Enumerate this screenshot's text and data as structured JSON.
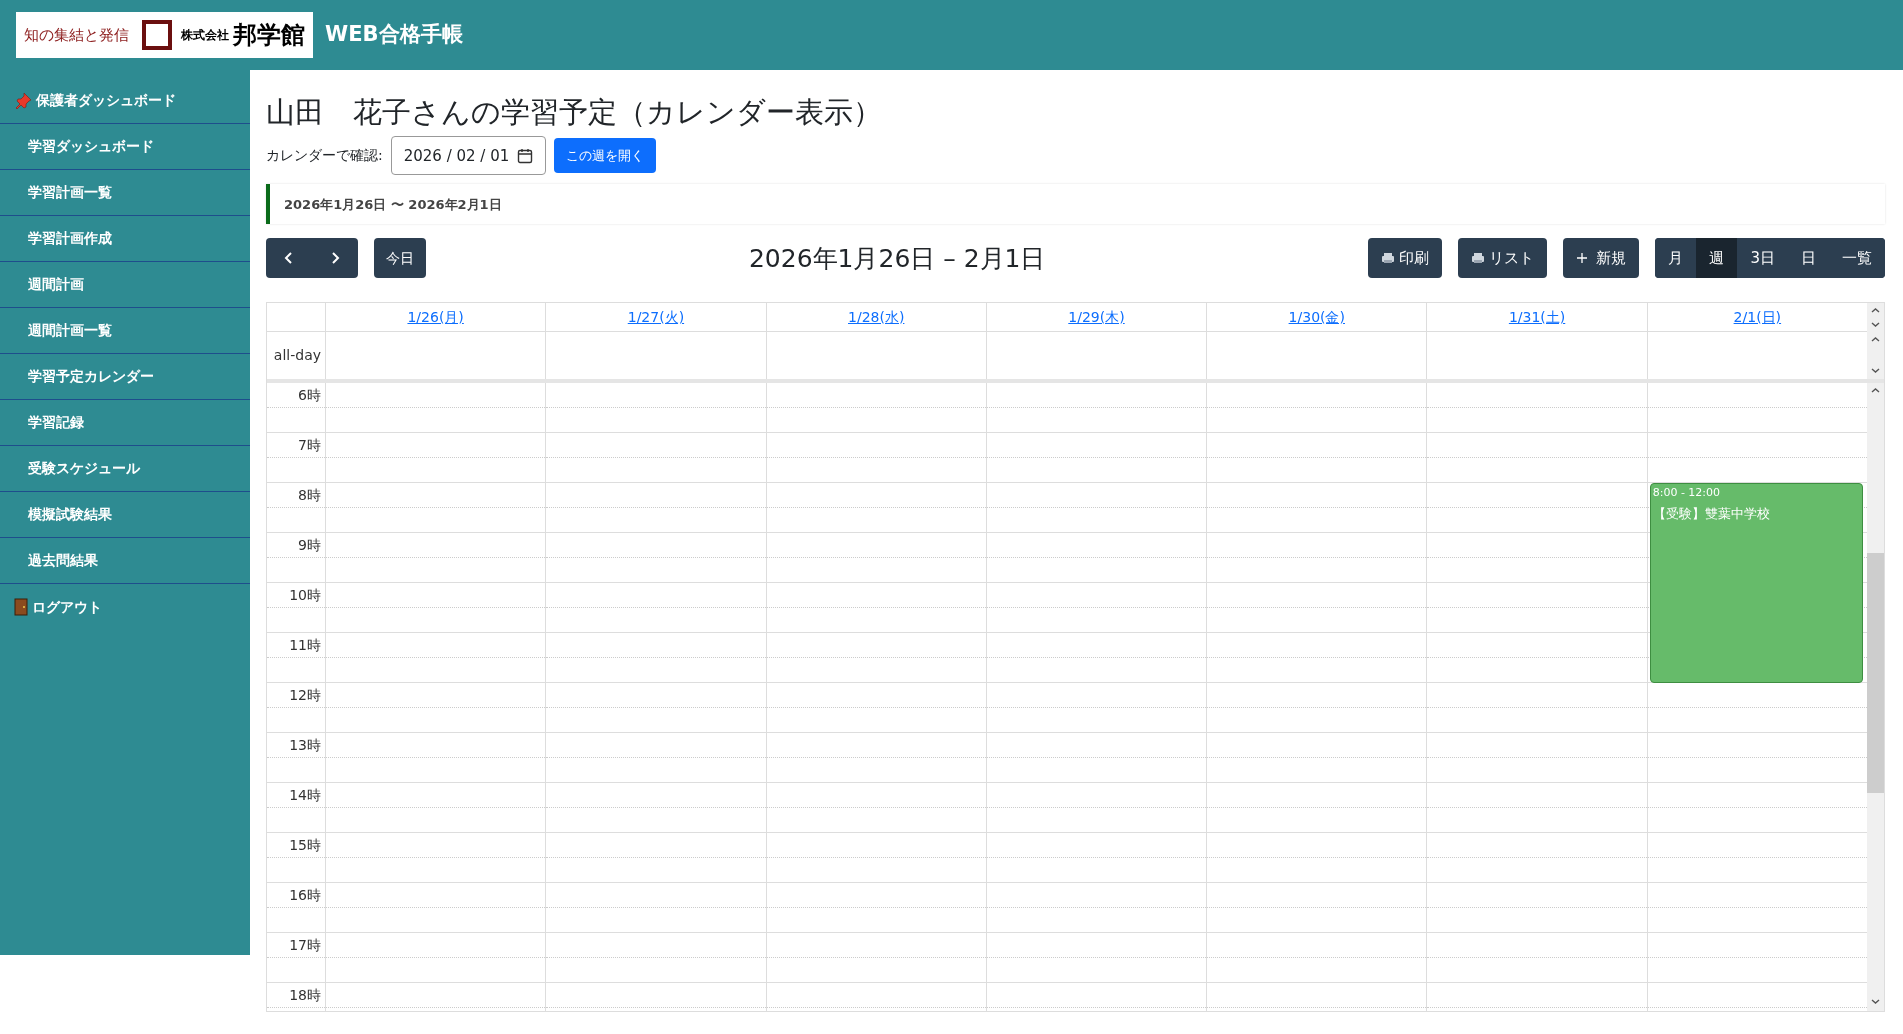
{
  "header": {
    "logo": {
      "tagline": "知の集結と発信",
      "company_prefix": "株式会社",
      "company_name": "邦学館"
    },
    "app_title": "WEB合格手帳"
  },
  "sidebar": {
    "items": [
      {
        "label": "保護者ダッシュボード",
        "kind": "pin"
      },
      {
        "label": "学習ダッシュボード",
        "kind": "link"
      },
      {
        "label": "学習計画一覧",
        "kind": "link"
      },
      {
        "label": "学習計画作成",
        "kind": "link"
      },
      {
        "label": "週間計画",
        "kind": "link"
      },
      {
        "label": "週間計画一覧",
        "kind": "link"
      },
      {
        "label": "学習予定カレンダー",
        "kind": "link"
      },
      {
        "label": "学習記録",
        "kind": "link"
      },
      {
        "label": "受験スケジュール",
        "kind": "link"
      },
      {
        "label": "模擬試験結果",
        "kind": "link"
      },
      {
        "label": "過去問結果",
        "kind": "link"
      },
      {
        "label": "ログアウト",
        "kind": "door"
      }
    ]
  },
  "page_title": "山田　花子さんの学習予定（カレンダー表示）",
  "date_picker": {
    "label": "カレンダーで確認:",
    "value": "2026 / 02 / 01"
  },
  "open_week_button": "この週を開く",
  "range_banner": "2026年1月26日 〜 2026年2月1日",
  "toolbar": {
    "today_button": "今日",
    "calendar_title": "2026年1月26日 – 2月1日",
    "actions": [
      {
        "label": "印刷",
        "kind": "printer"
      },
      {
        "label": "リスト",
        "kind": "printer"
      },
      {
        "label": "新規",
        "kind": "plus"
      }
    ],
    "views": [
      {
        "label": "月",
        "selected": false
      },
      {
        "label": "週",
        "selected": true
      },
      {
        "label": "3日",
        "selected": false
      },
      {
        "label": "日",
        "selected": false
      },
      {
        "label": "一覧",
        "selected": false
      }
    ]
  },
  "calendar": {
    "all_day_label": "all-day",
    "hours": [
      "6時",
      "7時",
      "8時",
      "9時",
      "10時",
      "11時",
      "12時",
      "13時",
      "14時",
      "15時",
      "16時",
      "17時",
      "18時"
    ],
    "days": [
      {
        "label": "1/26(月)"
      },
      {
        "label": "1/27(火)"
      },
      {
        "label": "1/28(水)"
      },
      {
        "label": "1/29(木)"
      },
      {
        "label": "1/30(金)"
      },
      {
        "label": "1/31(土)"
      },
      {
        "label": "2/1(日)",
        "events": [
          {
            "time": "8:00 - 12:00",
            "title": "【受験】雙葉中学校",
            "color": "#66bb6a"
          }
        ]
      }
    ]
  }
}
